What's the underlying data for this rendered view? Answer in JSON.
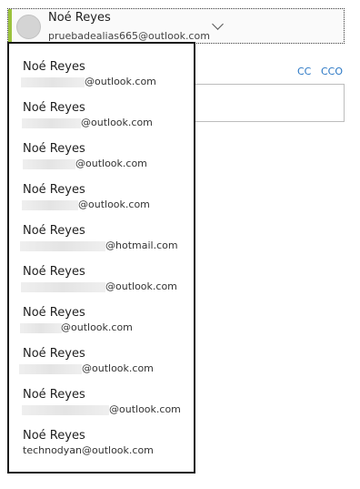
{
  "sender": {
    "name": "Noé Reyes",
    "email": "pruebadealias665@outlook.com",
    "accent_color": "#9bc23c"
  },
  "recipient_links": {
    "cc": "CC",
    "bcc": "CCO"
  },
  "accounts": [
    {
      "name": "Noé Reyes",
      "email_suffix": "@outlook.com"
    },
    {
      "name": "Noé Reyes",
      "email_suffix": "@outlook.com"
    },
    {
      "name": "Noé Reyes",
      "email_suffix": "@outlook.com"
    },
    {
      "name": "Noé Reyes",
      "email_suffix": "@outlook.com"
    },
    {
      "name": "Noé Reyes",
      "email_suffix": "@hotmail.com"
    },
    {
      "name": "Noé Reyes",
      "email_suffix": "@outlook.com"
    },
    {
      "name": "Noé Reyes",
      "email_suffix": "@outlook.com"
    },
    {
      "name": "Noé Reyes",
      "email_suffix": "@outlook.com"
    },
    {
      "name": "Noé Reyes",
      "email_suffix": "@outlook.com"
    },
    {
      "name": "Noé Reyes",
      "email_suffix": "technodyan@outlook.com"
    }
  ],
  "icons": {
    "dropdown": "chevron-down-icon",
    "avatar": "avatar"
  }
}
